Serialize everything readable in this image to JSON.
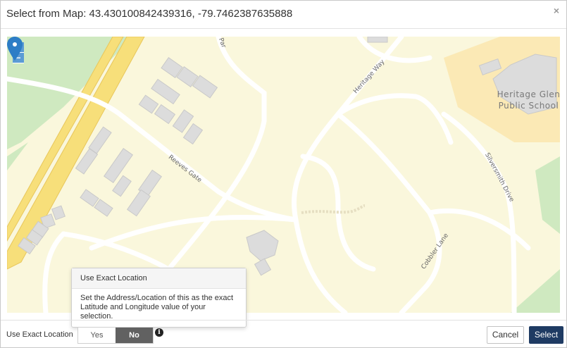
{
  "dialog": {
    "title": "Select from Map: 43.430100842439316, -79.7462387635888",
    "close_symbol": "×"
  },
  "map": {
    "zoom_in": "+",
    "zoom_out": "−",
    "streets": {
      "heritage_way": "Heritage Way",
      "reeves_gate": "Reeves Gate",
      "silversmith_drive": "Silversmith Drive",
      "cobbler_lane": "Cobbler Lane",
      "partial_top": "Par"
    },
    "school_line1": "Heritage Glen",
    "school_line2": "Public School",
    "marker_icon": "map-pin-icon",
    "colors": {
      "background": "#faf7dc",
      "highway": "#f7df7a",
      "green": "#cfe9c0",
      "building": "#dcdcdc",
      "marker": "#2d7dc6"
    }
  },
  "tooltip": {
    "title": "Use Exact Location",
    "body": "Set the Address/Location of this as the exact Latitude and Longitude value of your selection."
  },
  "footer": {
    "exact_label": "Use Exact Location",
    "yes_label": "Yes",
    "no_label": "No",
    "selected": "No",
    "info_symbol": "i",
    "cancel_label": "Cancel",
    "select_label": "Select",
    "primary_color": "#1f3b63"
  }
}
